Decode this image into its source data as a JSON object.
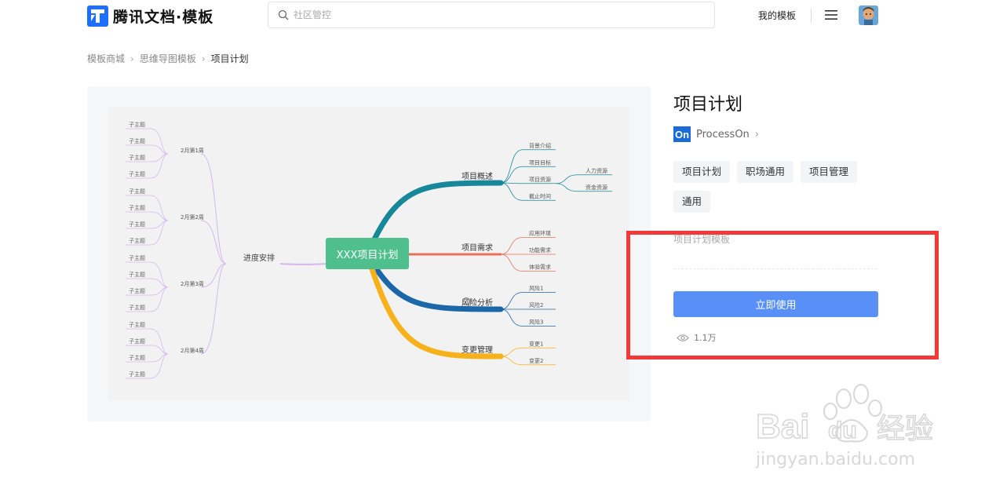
{
  "header": {
    "logo_text": "腾讯文档·模板",
    "search_placeholder": "社区管控",
    "my_templates": "我的模板"
  },
  "breadcrumb": [
    "模板商城",
    "思维导图模板",
    "项目计划"
  ],
  "mindmap": {
    "center": "XXX项目计划",
    "left_branch": "进度安排",
    "weeks": [
      "2月第1周",
      "2月第2周",
      "2月第3周",
      "2月第4周"
    ],
    "subtopic": "子主题",
    "right_branches": [
      {
        "label": "项目概述",
        "color": "#17879a",
        "children": [
          "背景介绍",
          "项目目标",
          "项目资源",
          "截止时间"
        ],
        "grand": [
          "人力资源",
          "资金资源"
        ]
      },
      {
        "label": "项目需求",
        "color": "#e8705a",
        "children": [
          "应用环境",
          "功能需求",
          "体验需求"
        ]
      },
      {
        "label": "风险分析",
        "color": "#1b67a8",
        "children": [
          "风险1",
          "风险2",
          "风险3"
        ]
      },
      {
        "label": "变更管理",
        "color": "#f7b21b",
        "children": [
          "变更1",
          "变更2"
        ]
      }
    ]
  },
  "template": {
    "title": "项目计划",
    "author": "ProcessOn",
    "author_logo": "On",
    "tags": [
      "项目计划",
      "职场通用",
      "项目管理",
      "通用"
    ],
    "description": "项目计划模板",
    "use_button": "立即使用",
    "views": "1.1万"
  },
  "watermark": {
    "brand_a": "Bai",
    "brand_b": "du",
    "brand_cn": "经验",
    "url": "jingyan.baidu.com"
  },
  "colors": {
    "accent": "#5890f8",
    "highlight_box": "#f23838",
    "center_node": "#4fc08d"
  }
}
